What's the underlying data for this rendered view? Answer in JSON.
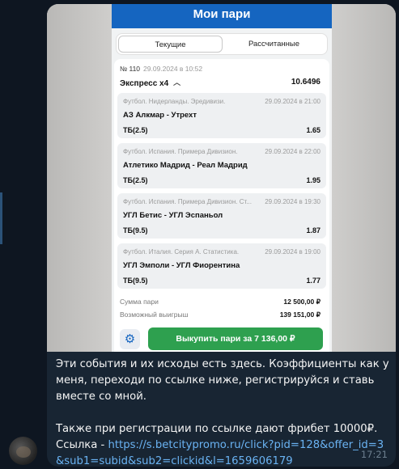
{
  "screen": {
    "title": "Мои пари",
    "tabs": [
      "Текущие",
      "Рассчитанные"
    ],
    "bet_number": "№ 110",
    "bet_date": "29.09.2024 в 10:52",
    "express_label": "Экспресс х4",
    "express_odds": "10.6496",
    "events": [
      {
        "league": "Футбол. Нидерланды. Эредивизи.",
        "date": "29.09.2024 в 21:00",
        "teams": "АЗ Алкмар - Утрехт",
        "market": "ТБ(2.5)",
        "odds": "1.65"
      },
      {
        "league": "Футбол. Испания. Примера Дивизион.",
        "date": "29.09.2024 в 22:00",
        "teams": "Атлетико Мадрид - Реал Мадрид",
        "market": "ТБ(2.5)",
        "odds": "1.95"
      },
      {
        "league": "Футбол. Испания. Примера Дивизион. Ст...",
        "date": "29.09.2024 в 19:30",
        "teams": "УГЛ Бетис - УГЛ Эспаньол",
        "market": "ТБ(9.5)",
        "odds": "1.87"
      },
      {
        "league": "Футбол. Италия. Серия А. Статистика.",
        "date": "29.09.2024 в 19:00",
        "teams": "УГЛ Эмполи - УГЛ Фиорентина",
        "market": "ТБ(9.5)",
        "odds": "1.77"
      }
    ],
    "stake_label": "Сумма пари",
    "stake_value": "12 500,00 ₽",
    "win_label": "Возможный выигрыш",
    "win_value": "139 151,00 ₽",
    "settings_icon": "gear-icon",
    "cashout_label": "Выкупить пари за  7 136,00  ₽"
  },
  "message": {
    "line1": "Эти события и их исходы есть здесь. Коэффициенты как у меня, переходи по ссылке ниже, регистрируйся и ставь вместе со мной.",
    "line2": "Также при регистрации по ссылке дают фрибет 10000₽.",
    "link_prefix": "Ссылка - ",
    "link": "https://s.betcitypromo.ru/click?pid=128&offer_id=3&sub1=subid&sub2=clickid&l=1659606179",
    "time": "17:21"
  },
  "colors": {
    "background": "#0e1621",
    "bubble": "#182533",
    "header": "#1565c0",
    "cashout": "#2ea04f",
    "link": "#6ab3f3"
  }
}
